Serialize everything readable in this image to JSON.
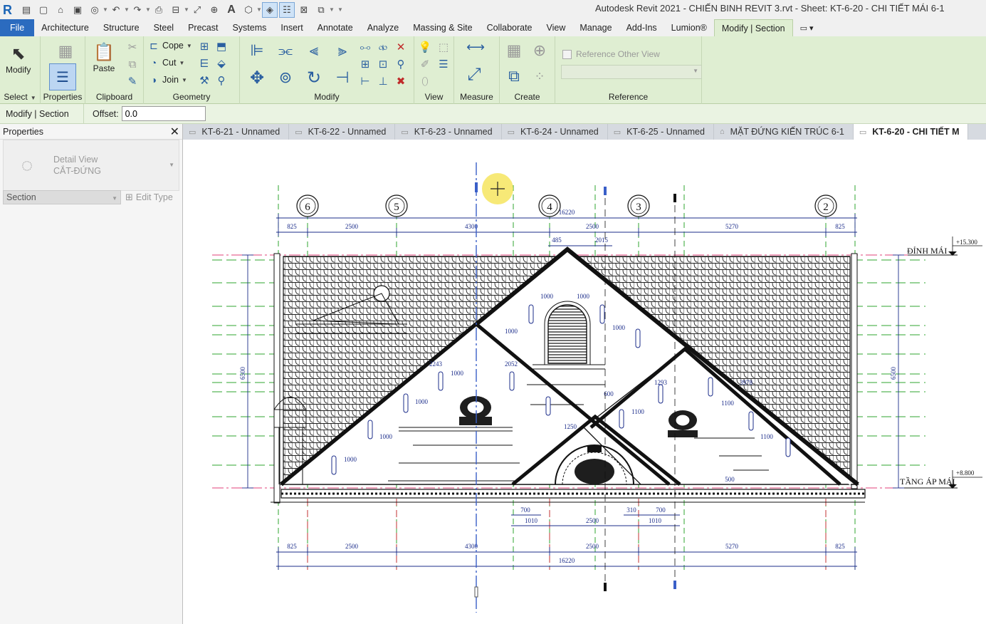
{
  "window": {
    "title": "Autodesk Revit 2021 - CHIẾN BINH REVIT 3.rvt - Sheet: KT-6-20 - CHI TIẾT MÁI 6-1"
  },
  "menu": {
    "tabs": [
      {
        "label": "File"
      },
      {
        "label": "Architecture"
      },
      {
        "label": "Structure"
      },
      {
        "label": "Steel"
      },
      {
        "label": "Precast"
      },
      {
        "label": "Systems"
      },
      {
        "label": "Insert"
      },
      {
        "label": "Annotate"
      },
      {
        "label": "Analyze"
      },
      {
        "label": "Massing & Site"
      },
      {
        "label": "Collaborate"
      },
      {
        "label": "View"
      },
      {
        "label": "Manage"
      },
      {
        "label": "Add-Ins"
      },
      {
        "label": "Lumion®"
      },
      {
        "label": "Modify | Section"
      }
    ]
  },
  "ribbon": {
    "modify_label": "Modify",
    "select_label": "Select",
    "properties_label": "Properties",
    "paste_label": "Paste",
    "clipboard_label": "Clipboard",
    "cope_label": "Cope",
    "cut_label": "Cut",
    "join_label": "Join",
    "geometry_label": "Geometry",
    "modify_panel_label": "Modify",
    "view_label": "View",
    "measure_label": "Measure",
    "create_label": "Create",
    "reference_other_view": "Reference Other View",
    "reference_label": "Reference"
  },
  "options_bar": {
    "context": "Modify | Section",
    "offset_label": "Offset:",
    "offset_value": "0.0"
  },
  "properties": {
    "title": "Properties",
    "family": "Detail View",
    "type": "CẮT-ĐỨNG",
    "instance_filter": "Section",
    "edit_type": "Edit Type"
  },
  "view_tabs": [
    {
      "label": "KT-6-21 - Unnamed",
      "icon": "sheet-icon"
    },
    {
      "label": "KT-6-22 - Unnamed",
      "icon": "sheet-icon"
    },
    {
      "label": "KT-6-23 - Unnamed",
      "icon": "sheet-icon"
    },
    {
      "label": "KT-6-24 - Unnamed",
      "icon": "sheet-icon"
    },
    {
      "label": "KT-6-25 - Unnamed",
      "icon": "sheet-icon"
    },
    {
      "label": "MẶT ĐỨNG KIẾN TRÚC 6-1",
      "icon": "elevation-icon"
    },
    {
      "label": "KT-6-20 - CHI TIẾT M",
      "icon": "sheet-icon",
      "active": true
    }
  ],
  "drawing": {
    "grid_labels": [
      "6",
      "5",
      "4",
      "3",
      "2"
    ],
    "top_dims": [
      "825",
      "2500",
      "4300",
      "2500",
      "5270",
      "825"
    ],
    "top_total": "16220",
    "bottom_dims": [
      "825",
      "2500",
      "4300",
      "2500",
      "5270",
      "825"
    ],
    "bottom_total": "16220",
    "level_top_name": "ĐỈNH MÁI",
    "level_top_value": "+15.300",
    "level_bottom_name": "TẦNG ÁP MÁI",
    "level_bottom_value": "+8.800",
    "height_dim": "6500",
    "inner_dims": [
      "485",
      "2015",
      "1000",
      "1000",
      "1000",
      "1000",
      "2243",
      "1000",
      "2052",
      "1000",
      "1000",
      "1000",
      "1250",
      "1100",
      "1100",
      "1100",
      "500",
      "700",
      "1010",
      "2500",
      "310",
      "700",
      "1010",
      "600",
      "1293",
      "3978"
    ],
    "colors": {
      "dim": "#1b2c8a",
      "level_line": "#e0407a",
      "ref_line": "#2fa52f",
      "section": "#3a5fc8"
    }
  }
}
